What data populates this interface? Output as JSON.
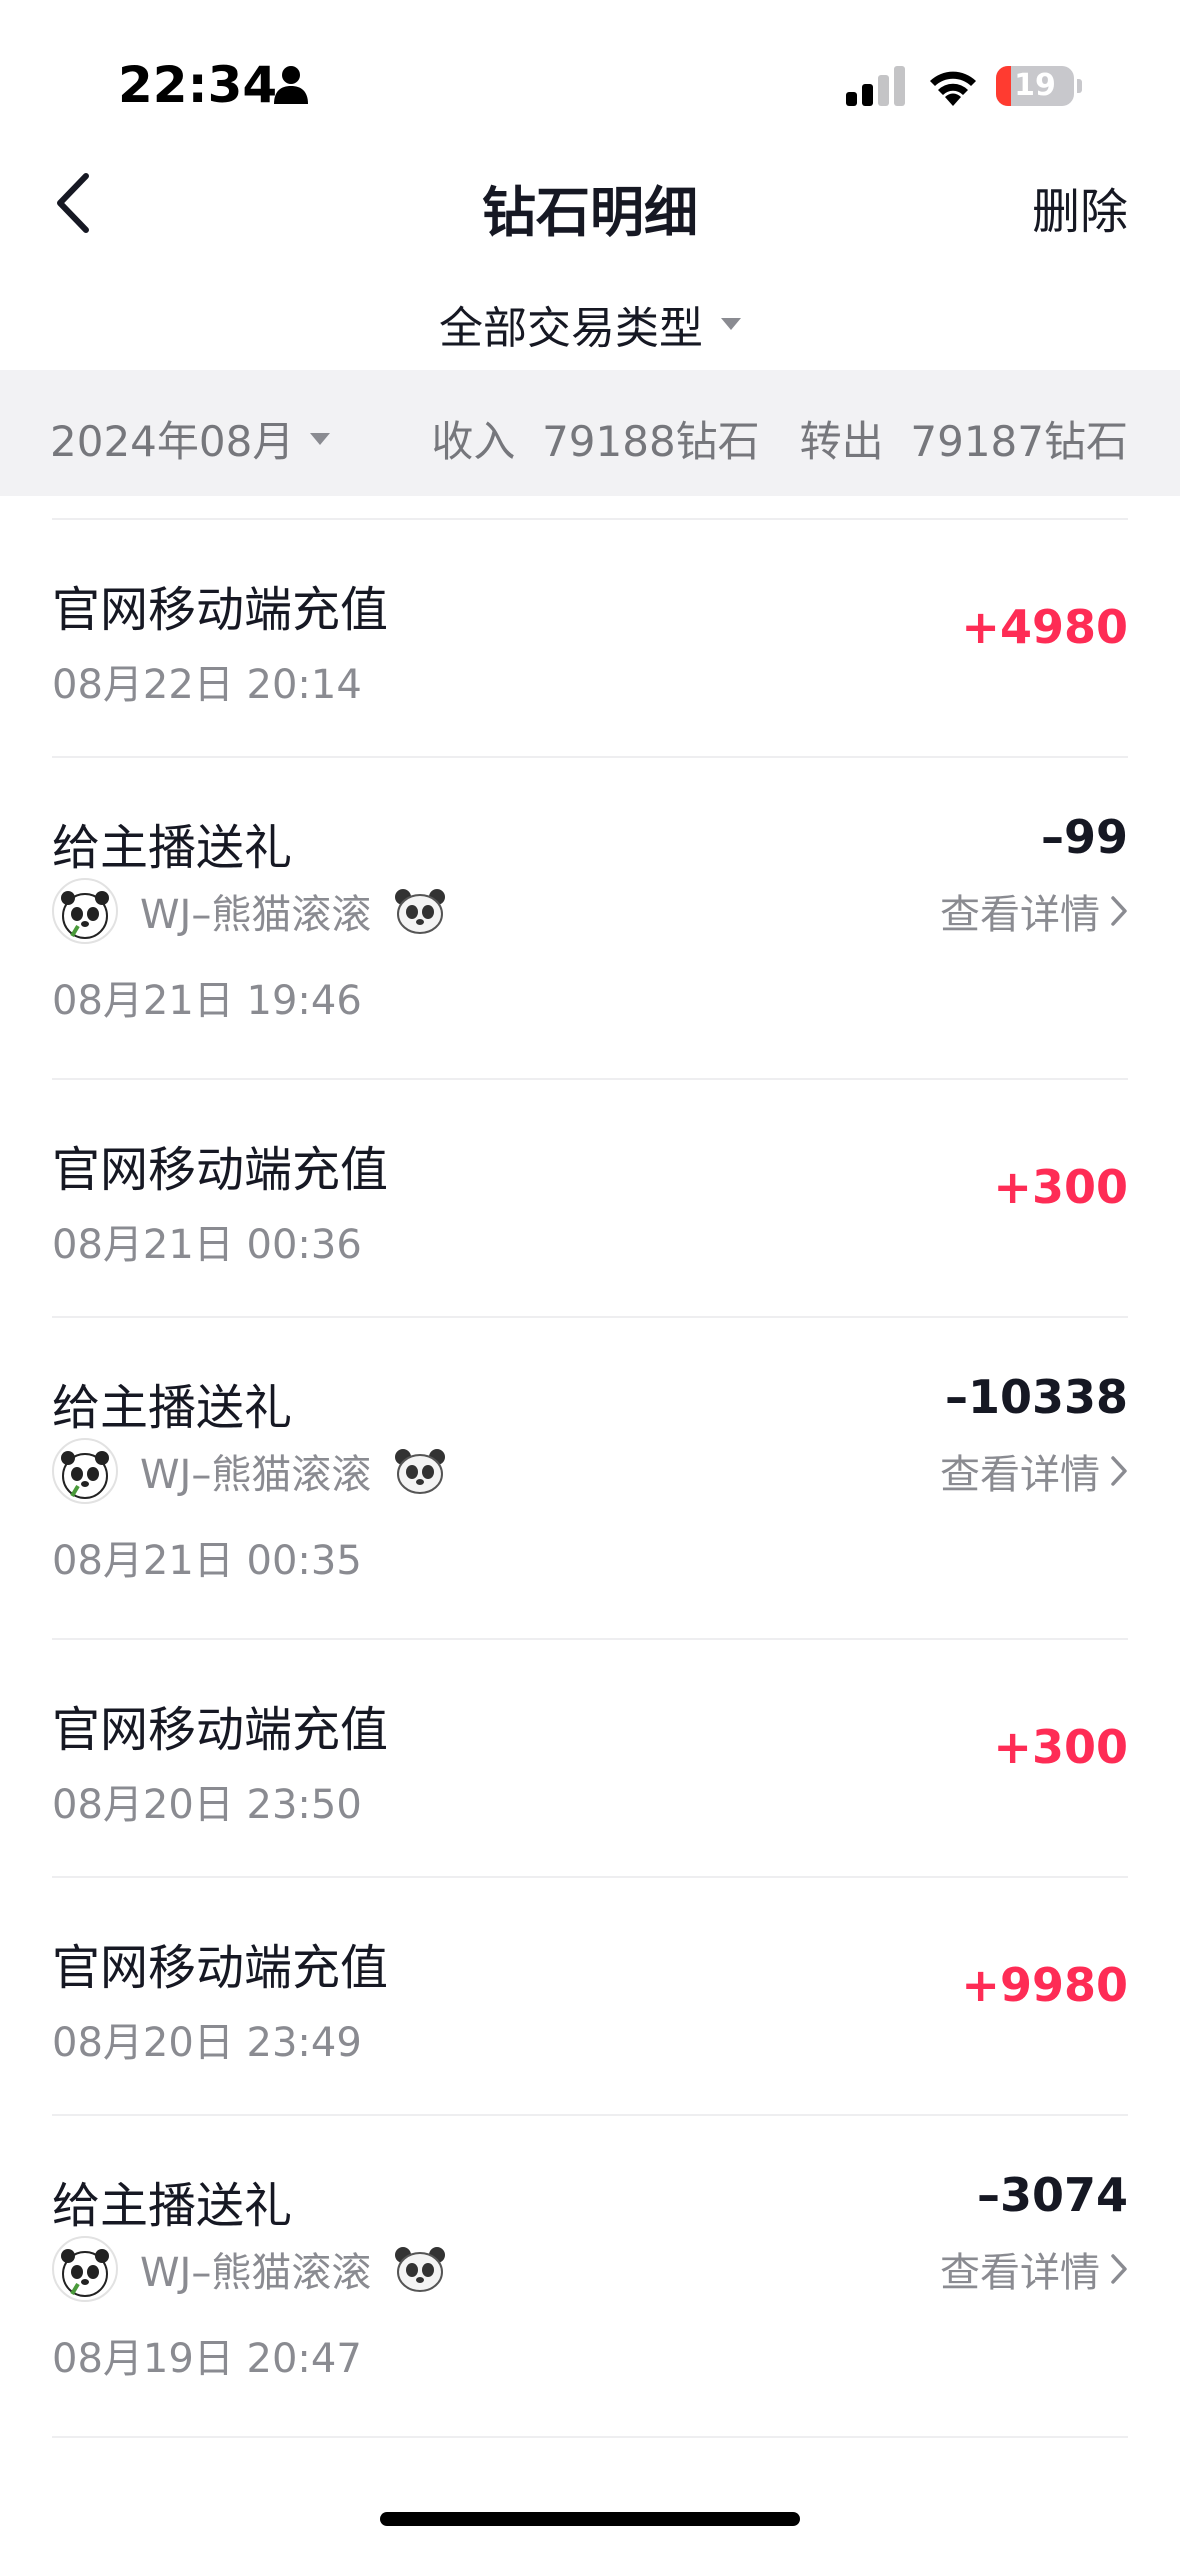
{
  "status_bar": {
    "time": "22:34",
    "battery_level": "19",
    "battery_fraction": 0.19
  },
  "nav": {
    "title": "钻石明细",
    "delete_label": "删除"
  },
  "filter": {
    "label": "全部交易类型"
  },
  "summary": {
    "month": "2024年08月",
    "income_label": "收入",
    "income_value": "79188钻石",
    "out_label": "转出",
    "out_value": "79187钻石"
  },
  "transactions": [
    {
      "title": "官网移动端充值",
      "time": "08月22日 20:14",
      "amount": "+4980"
    },
    {
      "title": "给主播送礼",
      "recipient": "WJ–熊猫滚滚",
      "detail": "查看详情",
      "time": "08月21日 19:46",
      "amount": "–99"
    },
    {
      "title": "官网移动端充值",
      "time": "08月21日 00:36",
      "amount": "+300"
    },
    {
      "title": "给主播送礼",
      "recipient": "WJ–熊猫滚滚",
      "detail": "查看详情",
      "time": "08月21日 00:35",
      "amount": "–10338"
    },
    {
      "title": "官网移动端充值",
      "time": "08月20日 23:50",
      "amount": "+300"
    },
    {
      "title": "官网移动端充值",
      "time": "08月20日 23:49",
      "amount": "+9980"
    },
    {
      "title": "给主播送礼",
      "recipient": "WJ–熊猫滚滚",
      "detail": "查看详情",
      "time": "08月19日 20:47",
      "amount": "–3074"
    }
  ],
  "colors": {
    "positive": "#fe2c55",
    "negative": "#161823",
    "muted": "#8a8b91",
    "summary_bg": "#f2f2f4"
  }
}
